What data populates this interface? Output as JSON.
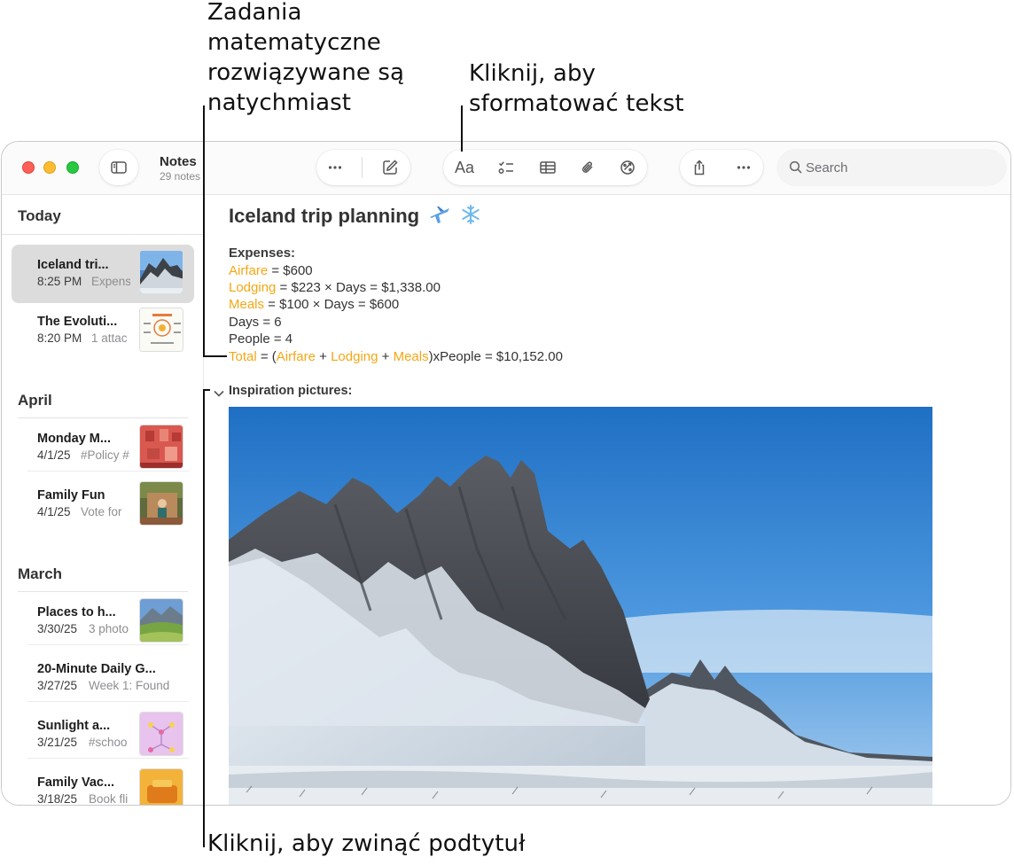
{
  "callouts": {
    "math": "Zadania\nmatematyczne\nrozwiązywane są\nnatychmiast",
    "format": "Kliknij, aby\nsformatować tekst",
    "collapse": "Kliknij, aby zwinąć podtytuł"
  },
  "window": {
    "app_title": "Notes",
    "note_count": "29 notes",
    "search_placeholder": "Search",
    "toolbar_icons": [
      "sidebar-toggle-icon",
      "more-icon",
      "compose-icon",
      "text-format-icon",
      "checklist-icon",
      "table-icon",
      "attachment-icon",
      "collaborate-icon",
      "share-icon",
      "more-icon"
    ],
    "format_button_label": "Aa"
  },
  "sidebar": {
    "sections": [
      {
        "label": "Today",
        "notes": [
          {
            "title": "Iceland tri...",
            "date": "8:25 PM",
            "preview": "Expens",
            "selected": true
          },
          {
            "title": "The Evoluti...",
            "date": "8:20 PM",
            "preview": "1 attac"
          }
        ]
      },
      {
        "label": "April",
        "notes": [
          {
            "title": "Monday M...",
            "date": "4/1/25",
            "preview": "#Policy #"
          },
          {
            "title": "Family Fun",
            "date": "4/1/25",
            "preview": "Vote for"
          }
        ]
      },
      {
        "label": "March",
        "notes": [
          {
            "title": "Places to h...",
            "date": "3/30/25",
            "preview": "3 photo"
          },
          {
            "title": "20-Minute Daily G...",
            "date": "3/27/25",
            "preview": "Week 1: Found"
          },
          {
            "title": "Sunlight a...",
            "date": "3/21/25",
            "preview": "#schoo"
          },
          {
            "title": "Family Vac...",
            "date": "3/18/25",
            "preview": "Book fli"
          }
        ]
      }
    ]
  },
  "note": {
    "title": "Iceland trip planning",
    "title_emoji": [
      "airplane",
      "snowflake"
    ],
    "expenses_heading": "Expenses:",
    "lines": {
      "airfare_var": "Airfare",
      "airfare_rest": " = $600",
      "lodging_var": "Lodging",
      "lodging_rest": " = $223 × Days = $1,338.00",
      "meals_var": "Meals",
      "meals_rest": " = $100 × Days = $600",
      "days": "Days = 6",
      "people": "People = 4",
      "total_var": "Total",
      "total_eq": " = (",
      "t_airfare": "Airfare",
      "t_plus1": " + ",
      "t_lodging": "Lodging",
      "t_plus2": " + ",
      "t_meals": "Meals",
      "t_rest": ")xPeople = $10,152.00"
    },
    "subheading": "Inspiration pictures:",
    "variable_color": "#f5a716"
  }
}
